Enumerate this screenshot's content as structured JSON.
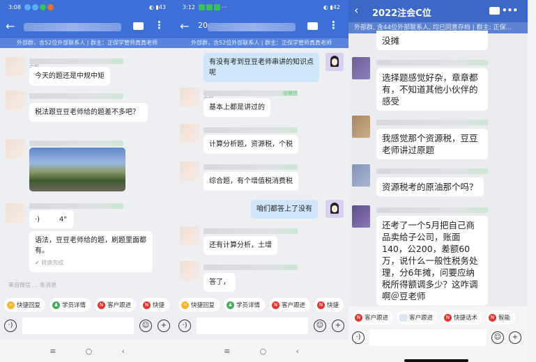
{
  "panel1": {
    "time": "3:08",
    "battery": "43",
    "subheader": "外部群，含52位外部联系人 | 群主：正保学管师真真老师",
    "sender": "会税",
    "messages": [
      "今天的题还是中规中矩",
      "税法跟豆豆老师给的题差不多吧？",
      "4\"",
      "语法，豆豆老师给的题，刷题里面都有。"
    ],
    "convert_status": "转换完成",
    "source_note": "来自微信 … 条消息"
  },
  "panel2": {
    "time": "3:12",
    "battery": "42",
    "title_prefix": "20",
    "subheader": "外部群，含52位外部联系人 | 群主：正保学管师真真老师",
    "wechat_tag": "@微信",
    "sender": "会税",
    "messages": [
      "有没有考到豆豆老师串讲的知识点呢",
      "基本上都是讲过的",
      "计算分析题，资源税，个税",
      "综合题，有个增值税消费税",
      "咱们都答上了没有",
      "还有计算分析，土增",
      "答了，"
    ]
  },
  "panel3": {
    "title": "2022注会C位",
    "subheader": "外部群, 含44位外部联系人, 均已同意存档 | 群主: 正保...",
    "messages": [
      "没摊",
      "选择题感觉好杂，章章都有，不知道其他小伙伴的感受",
      "我感觉那个资源税，豆豆老师讲过原题",
      "资源税考的原油那个吗？",
      "还考了一个5月把自己商品卖给子公司，账面140，公200，差额60万，说什么一般性税务处理，分6年摊，问要应纳税所得额调多少？这咋调啊＠豆老师"
    ]
  },
  "chips1": [
    "快捷回复",
    "学员详情",
    "客户跟进",
    "快捷"
  ],
  "chips3": [
    "客户跟进",
    "客户跟进",
    "快捷话术",
    "智能"
  ],
  "colors": {
    "header": "#3d6fd6",
    "bubble_me": "#cfe6fb"
  }
}
